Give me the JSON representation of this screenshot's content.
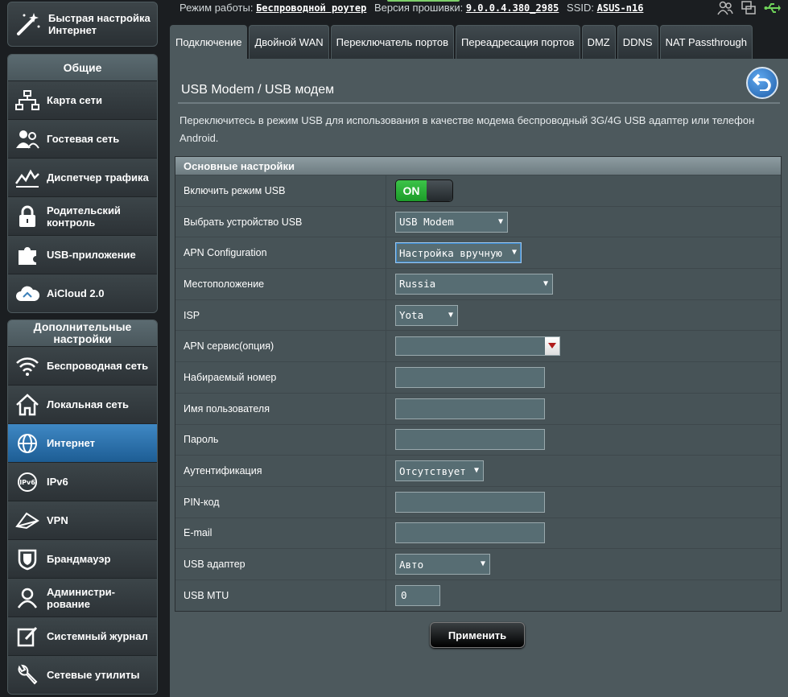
{
  "colors": {
    "accent": "#3f88c4",
    "panel": "#4d595d",
    "toggle_on": "#1c9b29"
  },
  "sidebar": {
    "quick_setup": {
      "label": "Быстрая настройка Интернет",
      "icon": "wand-icon"
    },
    "general_header": "Общие",
    "general": [
      {
        "label": "Карта сети",
        "icon": "network-map-icon"
      },
      {
        "label": "Гостевая сеть",
        "icon": "guest-network-icon"
      },
      {
        "label": "Диспетчер трафика",
        "icon": "traffic-manager-icon"
      },
      {
        "label": "Родительский контроль",
        "icon": "lock-icon"
      },
      {
        "label": "USB-приложение",
        "icon": "puzzle-icon"
      },
      {
        "label": "AiCloud 2.0",
        "icon": "cloud-icon"
      }
    ],
    "advanced_header": "Дополнительные настройки",
    "advanced": [
      {
        "label": "Беспроводная сеть",
        "icon": "wifi-icon"
      },
      {
        "label": "Локальная сеть",
        "icon": "home-icon"
      },
      {
        "label": "Интернет",
        "icon": "globe-icon",
        "active": true
      },
      {
        "label": "IPv6",
        "icon": "ipv6-icon"
      },
      {
        "label": "VPN",
        "icon": "vpn-icon"
      },
      {
        "label": "Брандмауэр",
        "icon": "shield-icon"
      },
      {
        "label": "Администри-рование",
        "icon": "admin-icon"
      },
      {
        "label": "Системный журнал",
        "icon": "log-icon"
      },
      {
        "label": "Сетевые утилиты",
        "icon": "wrench-icon"
      }
    ]
  },
  "topbar": {
    "mode_label": "Режим работы:",
    "mode_value": "Беспроводной роутер",
    "fw_label": "Версия прошивки:",
    "fw_value": "9.0.0.4.380_2985",
    "ssid_label": "SSID:",
    "ssid_value": "ASUS-n16"
  },
  "tabs": [
    {
      "label": "Подключение",
      "active": true
    },
    {
      "label": "Двойной WAN"
    },
    {
      "label": "Переключатель портов"
    },
    {
      "label": "Переадресация портов"
    },
    {
      "label": "DMZ"
    },
    {
      "label": "DDNS"
    },
    {
      "label": "NAT Passthrough"
    }
  ],
  "main": {
    "title": "USB Modem / USB модем",
    "description": "Переключитесь в режим USB для использования в качестве модема беспроводный 3G/4G USB адаптер или телефон Android.",
    "section_title": "Основные настройки",
    "fields": {
      "usb_mode": {
        "label": "Включить режим USB",
        "value": "ON"
      },
      "usb_device": {
        "label": "Выбрать устройство USB",
        "value": "USB Modem"
      },
      "apn_config": {
        "label": "APN Configuration",
        "value": "Настройка вручную"
      },
      "location": {
        "label": "Местоположение",
        "value": "Russia"
      },
      "isp": {
        "label": "ISP",
        "value": "Yota"
      },
      "apn_service": {
        "label": "APN сервис(опция)",
        "value": ""
      },
      "dial_number": {
        "label": "Набираемый номер",
        "value": ""
      },
      "username": {
        "label": "Имя пользователя",
        "value": ""
      },
      "password": {
        "label": "Пароль",
        "value": ""
      },
      "auth": {
        "label": "Аутентификация",
        "value": "Отсутствует"
      },
      "pin": {
        "label": "PIN-код",
        "value": ""
      },
      "email": {
        "label": "E-mail",
        "value": ""
      },
      "usb_adapter": {
        "label": "USB адаптер",
        "value": "Авто"
      },
      "usb_mtu": {
        "label": "USB MTU",
        "value": "0"
      }
    },
    "apply_label": "Применить"
  }
}
